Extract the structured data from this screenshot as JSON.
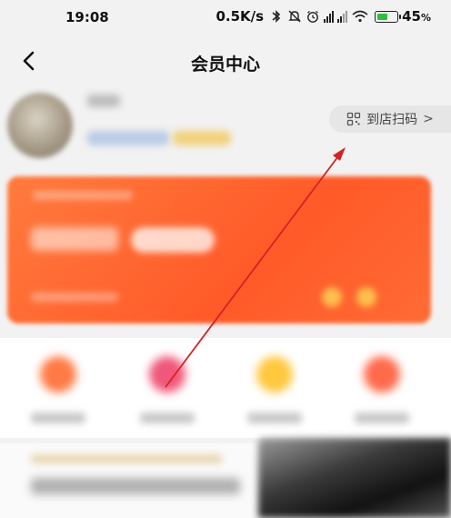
{
  "status_bar": {
    "time": "19:08",
    "network_speed": "0.5K/s",
    "battery_percent": "45",
    "battery_suffix": "%",
    "icons": [
      "bluetooth-icon",
      "mute-bell-icon",
      "alarm-icon",
      "hd-signal-icon",
      "hd-signal-icon",
      "wifi-icon",
      "battery-charging-icon"
    ]
  },
  "header": {
    "title": "会员中心",
    "back_icon": "chevron-left-icon"
  },
  "profile": {
    "scan_button_label": "到店扫码",
    "scan_icon": "qr-scan-icon",
    "scan_chevron": ">"
  },
  "colors": {
    "card_orange": "#ff5a28",
    "annotation_arrow": "#d22323",
    "background": "#f2f2f2"
  }
}
